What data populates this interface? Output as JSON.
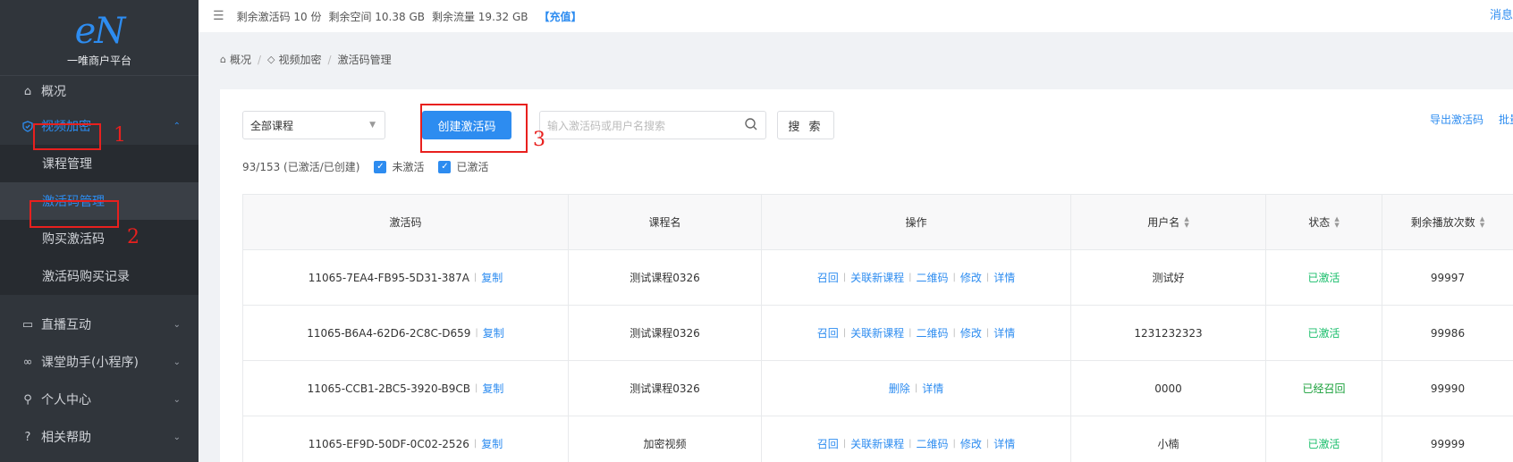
{
  "sidebar": {
    "logo_mark": "eN",
    "logo_text": "一唯商户平台",
    "items": [
      {
        "label": "概况",
        "icon": "home-icon"
      },
      {
        "label": "视频加密",
        "icon": "shield-icon"
      },
      {
        "label": "直播互动",
        "icon": "video-icon"
      },
      {
        "label": "课堂助手(小程序)",
        "icon": "link-icon"
      },
      {
        "label": "个人中心",
        "icon": "user-icon"
      },
      {
        "label": "相关帮助",
        "icon": "help-icon"
      }
    ],
    "sub_items": [
      {
        "label": "课程管理"
      },
      {
        "label": "激活码管理"
      },
      {
        "label": "购买激活码"
      },
      {
        "label": "激活码购买记录"
      }
    ]
  },
  "annotations": [
    "1",
    "2",
    "3"
  ],
  "topbar": {
    "stat1": "剩余激活码 10 份",
    "stat2": "剩余空间 10.38 GB",
    "stat3": "剩余流量 19.32 GB",
    "recharge": "【充值】",
    "msg": "消息"
  },
  "breadcrumb": [
    "概况",
    "视频加密",
    "激活码管理"
  ],
  "toolbar": {
    "course_select": "全部课程",
    "create_button": "创建激活码",
    "search_placeholder": "输入激活码或用户名搜索",
    "search_button": "搜 索",
    "export_link": "导出激活码",
    "batch_link": "批量"
  },
  "filter": {
    "summary": "93/153 (已激活/已创建)",
    "cb_inactive": "未激活",
    "cb_active": "已激活"
  },
  "table": {
    "headers": [
      "激活码",
      "课程名",
      "操作",
      "用户名",
      "状态",
      "剩余播放次数"
    ],
    "copy_label": "复制",
    "rows": [
      {
        "code": "11065-7EA4-FB95-5D31-387A",
        "course": "测试课程0326",
        "actions": [
          "召回",
          "关联新课程",
          "二维码",
          "修改",
          "详情"
        ],
        "user": "测试好",
        "status": "已激活",
        "remaining": "99997"
      },
      {
        "code": "11065-B6A4-62D6-2C8C-D659",
        "course": "测试课程0326",
        "actions": [
          "召回",
          "关联新课程",
          "二维码",
          "修改",
          "详情"
        ],
        "user": "1231232323",
        "status": "已激活",
        "remaining": "99986"
      },
      {
        "code": "11065-CCB1-2BC5-3920-B9CB",
        "course": "测试课程0326",
        "actions": [
          "删除",
          "详情"
        ],
        "user": "0000",
        "status": "已经召回",
        "remaining": "99990"
      },
      {
        "code": "11065-EF9D-50DF-0C02-2526",
        "course": "加密视频",
        "actions": [
          "召回",
          "关联新课程",
          "二维码",
          "修改",
          "详情"
        ],
        "user": "小楠",
        "status": "已激活",
        "remaining": "99999"
      }
    ]
  },
  "colors": {
    "accent": "#2d8cf0",
    "sidebar_bg": "#30353b",
    "annotation": "#e8201e",
    "status_ok": "#19be6b"
  }
}
